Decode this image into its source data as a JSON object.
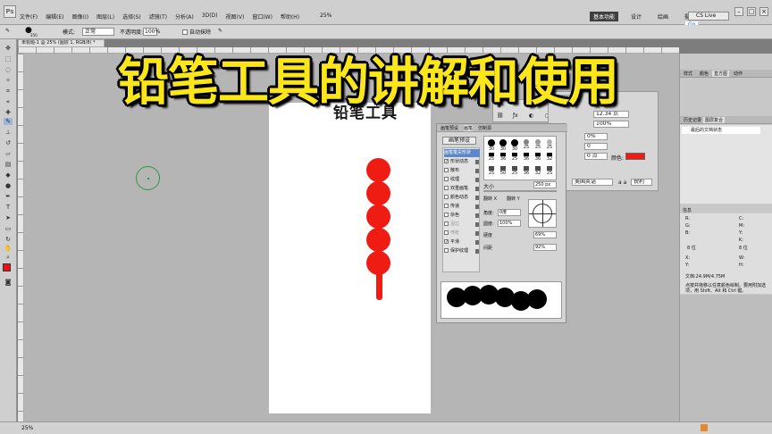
{
  "overlay": {
    "title": "铅笔工具的讲解和使用"
  },
  "menubar": {
    "logo": "Ps",
    "items": [
      "文件(F)",
      "编辑(E)",
      "图像(I)",
      "图层(L)",
      "选择(S)",
      "滤镜(T)",
      "分析(A)",
      "3D(D)",
      "视图(V)",
      "窗口(W)",
      "帮助(H)"
    ],
    "zoom": "25%",
    "workspaces": [
      "基本功能",
      "设计",
      "绘画",
      "摄影"
    ],
    "more": "»",
    "cs_live": "CS Live",
    "cloud_badge": "Go"
  },
  "options": {
    "brush_size": "250",
    "mode_label": "模式:",
    "mode_value": "正常",
    "opacity_label": "不透明度:",
    "opacity_value": "100%",
    "auto_erase_label": "自动抹除"
  },
  "document": {
    "tab_label": "未标题-1 @ 25% (图层 1, RGB/8) *",
    "canvas_text": "铅笔工具",
    "fg_color": "#ee1c13"
  },
  "char_panel": {
    "leading": "12.34 点",
    "tracking": "100%",
    "size": "100%",
    "kerning": "0%",
    "scale": "0",
    "baseline": "0 点",
    "color_label": "颜色:",
    "lang": "美国英语",
    "aa": "锐利",
    "aa_prefix": "a a"
  },
  "brush_panel": {
    "tabs": [
      "画笔预设",
      "画笔",
      "仿制源"
    ],
    "preset_button": "画笔预设",
    "options": [
      {
        "label": "画笔笔尖形状",
        "checked": false,
        "selected": true
      },
      {
        "label": "形状动态",
        "checked": true
      },
      {
        "label": "散布",
        "checked": false
      },
      {
        "label": "纹理",
        "checked": false
      },
      {
        "label": "双重画笔",
        "checked": false
      },
      {
        "label": "颜色动态",
        "checked": false
      },
      {
        "label": "传递",
        "checked": false
      },
      {
        "label": "杂色",
        "checked": false
      },
      {
        "label": "湿边",
        "checked": false,
        "dim": true
      },
      {
        "label": "喷枪",
        "checked": false,
        "dim": true
      },
      {
        "label": "平滑",
        "checked": true
      },
      {
        "label": "保护纹理",
        "checked": false
      }
    ],
    "tips": [
      "30",
      "30",
      "30",
      "25",
      "25",
      "25",
      "25",
      "36",
      "25",
      "36",
      "36",
      "32",
      "25",
      "50",
      "25",
      "36",
      "32",
      "25"
    ],
    "size_label": "大小",
    "size_value": "250 px",
    "flip_x": "翻转 X",
    "flip_y": "翻转 Y",
    "angle_label": "角度:",
    "angle_value": "0度",
    "roundness_label": "圆度:",
    "roundness_value": "100%",
    "hardness_label": "硬度",
    "hardness_value": "69%",
    "spacing_label": "间距",
    "spacing_value": "92%"
  },
  "right_dock": {
    "tabs_top": [
      "样式",
      "颜色",
      "直方图",
      "动作"
    ],
    "tabs_history": [
      "历史记录",
      "图层复合"
    ],
    "history_item": "最后的文档状态",
    "info_title": "信息",
    "info": {
      "r": "R:",
      "g": "G:",
      "b": "B:",
      "c": "C:",
      "m": "M:",
      "y": "Y:",
      "k": "K:",
      "bits_left": "8 位",
      "bits_right": "8 位",
      "x": "X:",
      "yy": "Y:",
      "w": "W:",
      "h": "H:",
      "doc": "文档:24.9M/4.75M",
      "hint": "点按并拖移以任意颜色绘制。要用附加选项，用 Shift、Alt 和 Ctrl 键。"
    }
  },
  "status": {
    "zoom": "25%"
  }
}
